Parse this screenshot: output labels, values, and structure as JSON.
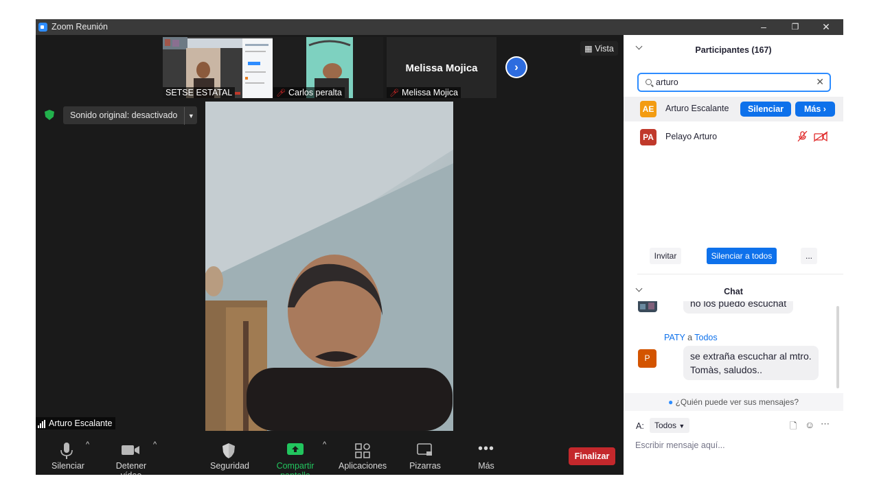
{
  "window": {
    "title": "Zoom Reunión",
    "controls": [
      "–",
      "❐",
      "✕"
    ]
  },
  "thumbnails": [
    {
      "name": "SETSE ESTATAL",
      "muted": false
    },
    {
      "name": "Carlos peralta",
      "muted": true
    },
    {
      "name": "Melissa Mojica",
      "muted": true,
      "big_name": "Melissa Mojica"
    }
  ],
  "view_button": {
    "label": "Vista"
  },
  "audio_status": {
    "label": "Sonido original: desactivado"
  },
  "speaker": {
    "name": "Arturo Escalante"
  },
  "toolbar": {
    "mute_label": "Silenciar",
    "video_label": "Detener vídeo",
    "security_label": "Seguridad",
    "share_label": "Compartir pantalla",
    "apps_label": "Aplicaciones",
    "whiteboard_label": "Pizarras",
    "more_label": "Más",
    "end_label": "Finalizar"
  },
  "participants_panel": {
    "title": "Participantes (167)",
    "search_value": "arturo",
    "participants": [
      {
        "initials": "AE",
        "name": "Arturo Escalante",
        "avatar_color": "#f39c12",
        "actions": [
          "Silenciar",
          "Más ›"
        ]
      },
      {
        "initials": "PA",
        "name": "Pelayo Arturo",
        "avatar_color": "#c0392b"
      }
    ],
    "invite_label": "Invitar",
    "mute_all_label": "Silenciar a todos",
    "more_label": "..."
  },
  "chat": {
    "title": "Chat",
    "messages": [
      {
        "text": "no los puedo escuchat"
      },
      {
        "sender": "PATY",
        "to_word": "a",
        "recipient": "Todos",
        "avatar": "P",
        "avatar_color": "#d35400",
        "text_line1": "se extraña escuchar al mtro.",
        "text_line2": "Tomàs, saludos.."
      }
    ],
    "who_can_see": "¿Quién puede ver sus mensajes?",
    "to_label": "A:",
    "to_value": "Todos",
    "input_placeholder": "Escribir mensaje aquí..."
  },
  "colors": {
    "accent_blue": "#0e71eb",
    "end_red": "#c4282c",
    "share_green": "#22c55e",
    "mute_red": "#e02828"
  }
}
